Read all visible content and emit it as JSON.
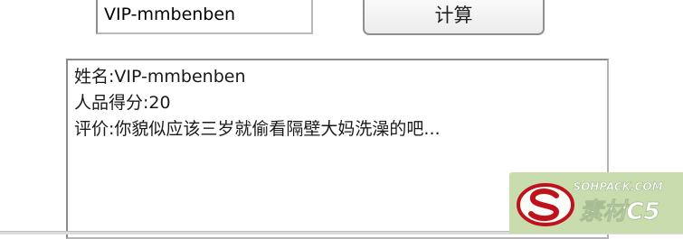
{
  "form": {
    "name_value": "VIP-mmbenben",
    "calc_label": "计算"
  },
  "result": {
    "name_line": "姓名:VIP-mmbenben",
    "score_line": "人品得分:20",
    "comment_line": "评价:你貌似应该三岁就偷看隔壁大妈洗澡的吧..."
  },
  "watermark": {
    "site_text": "SOHPACK.COM",
    "brand_text": "素材C5",
    "logo_icon": "soupack-logo-icon",
    "colors": {
      "background": "#c8dcae",
      "accent": "#c0121c"
    }
  }
}
